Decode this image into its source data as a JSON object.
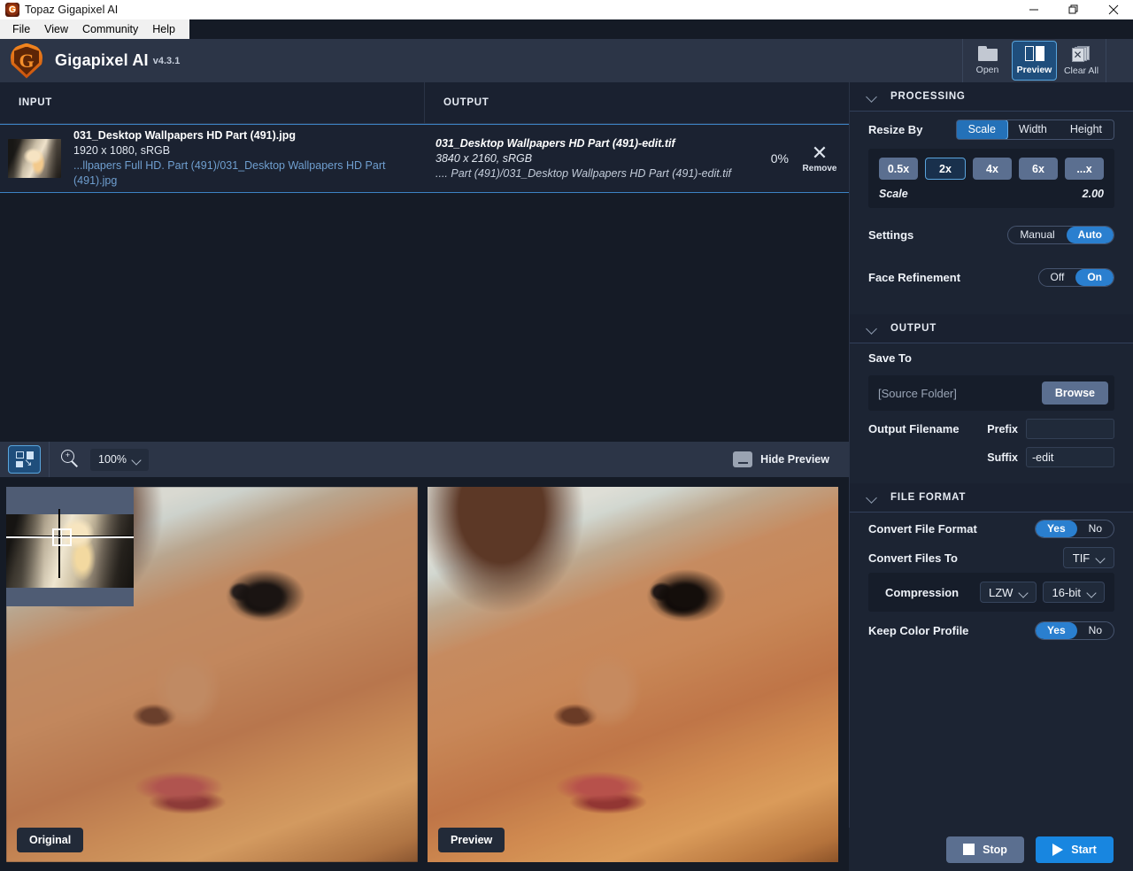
{
  "window": {
    "title": "Topaz Gigapixel AI",
    "icon": "app-logo-icon",
    "minimize": "minimize-icon",
    "maximize": "restore-icon",
    "close": "close-icon"
  },
  "menubar": {
    "items": [
      {
        "label": "File"
      },
      {
        "label": "View"
      },
      {
        "label": "Community"
      },
      {
        "label": "Help"
      }
    ]
  },
  "header": {
    "brand": "Gigapixel AI",
    "version": "v4.3.1",
    "buttons": [
      {
        "label": "Open",
        "icon": "folder-icon",
        "active": false
      },
      {
        "label": "Preview",
        "icon": "preview-split-icon",
        "active": true
      },
      {
        "label": "Clear All",
        "icon": "clear-all-icon",
        "active": false
      }
    ]
  },
  "columns": {
    "input": "INPUT",
    "output": "OUTPUT"
  },
  "file_row": {
    "input": {
      "name": "031_Desktop Wallpapers  HD Part (491).jpg",
      "dimensions": "1920 x 1080, sRGB",
      "path": "...llpapers Full HD. Part (491)/031_Desktop Wallpapers  HD Part (491).jpg"
    },
    "output": {
      "name": "031_Desktop Wallpapers  HD Part (491)-edit.tif",
      "dimensions": "3840 x 2160, sRGB",
      "path": ".... Part (491)/031_Desktop Wallpapers  HD Part (491)-edit.tif"
    },
    "progress": "0%",
    "remove_label": "Remove",
    "remove_icon": "close-x-icon"
  },
  "preview_toolbar": {
    "fit_icon": "fit-to-window-icon",
    "zoom_icon": "magnifier-plus-icon",
    "zoom_level": "100%",
    "hide_preview_label": "Hide Preview",
    "hide_preview_icon": "collapse-panel-icon"
  },
  "preview": {
    "original_label": "Original",
    "preview_label": "Preview",
    "navigator_icon": "navigator-thumbnail"
  },
  "sidebar": {
    "processing": {
      "title": "PROCESSING",
      "collapse_icon": "chevron-down-icon",
      "resize_by": {
        "label": "Resize By",
        "options": [
          "Scale",
          "Width",
          "Height"
        ],
        "selected": "Scale"
      },
      "scale_presets": [
        "0.5x",
        "2x",
        "4x",
        "6x",
        "...x"
      ],
      "scale_selected": "2x",
      "scale_label": "Scale",
      "scale_value": "2.00",
      "settings": {
        "label": "Settings",
        "options": [
          "Manual",
          "Auto"
        ],
        "selected": "Auto"
      },
      "face_refinement": {
        "label": "Face Refinement",
        "options": [
          "Off",
          "On"
        ],
        "selected": "On"
      }
    },
    "output": {
      "title": "OUTPUT",
      "collapse_icon": "chevron-down-icon",
      "save_to_label": "Save To",
      "save_to_value": "[Source Folder]",
      "browse_label": "Browse",
      "output_filename_label": "Output Filename",
      "prefix_label": "Prefix",
      "prefix_value": "",
      "suffix_label": "Suffix",
      "suffix_value": "-edit"
    },
    "file_format": {
      "title": "FILE FORMAT",
      "collapse_icon": "chevron-down-icon",
      "convert_file_format": {
        "label": "Convert File Format",
        "options": [
          "Yes",
          "No"
        ],
        "selected": "Yes"
      },
      "convert_files_to": {
        "label": "Convert Files To",
        "value": "TIF"
      },
      "compression": {
        "label": "Compression",
        "value": "LZW",
        "bit_depth": "16-bit"
      },
      "keep_color_profile": {
        "label": "Keep Color Profile",
        "options": [
          "Yes",
          "No"
        ],
        "selected": "Yes"
      }
    }
  },
  "footer": {
    "stop_label": "Stop",
    "stop_icon": "stop-square-icon",
    "start_label": "Start",
    "start_icon": "play-triangle-icon"
  },
  "colors": {
    "accent_blue": "#2471b8",
    "start_blue": "#1886e0",
    "panel_bg": "#1c2433",
    "app_bg": "#151b26",
    "header_bg": "#2c3547",
    "link_blue": "#6f9fd0",
    "logo_orange": "#f3871f"
  }
}
